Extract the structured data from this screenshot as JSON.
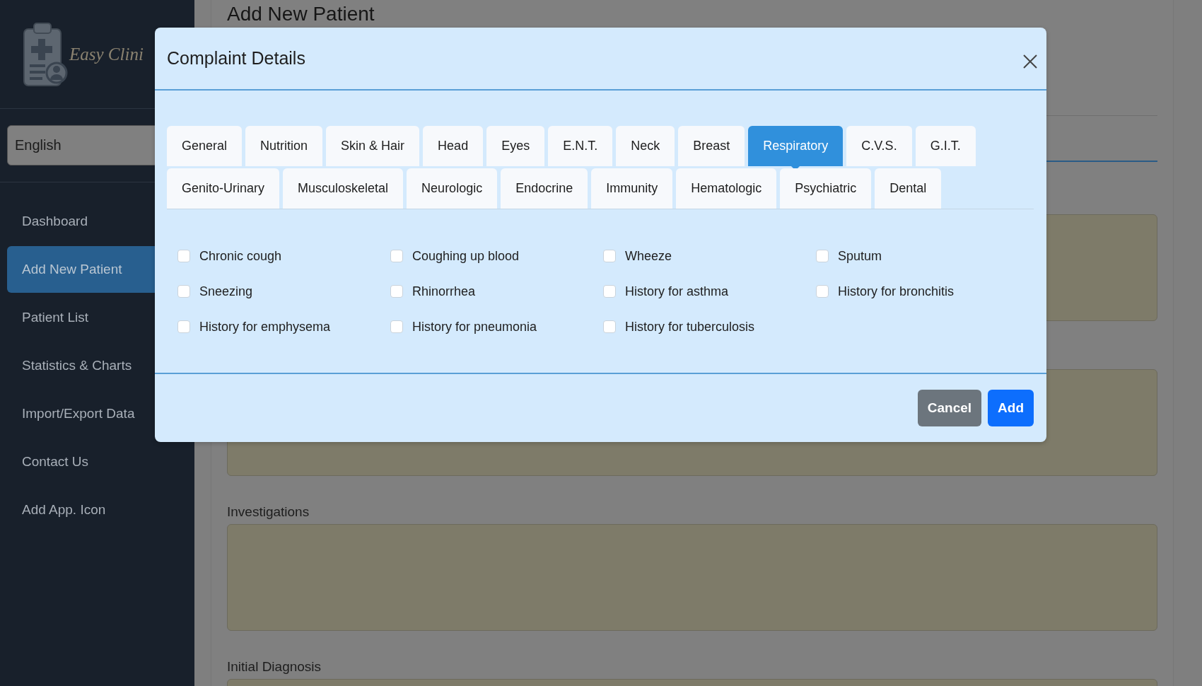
{
  "sidebar": {
    "logo_text": "Easy Clini",
    "language": "English",
    "items": [
      {
        "label": "Dashboard",
        "selected": false
      },
      {
        "label": "Add New Patient",
        "selected": true
      },
      {
        "label": "Patient List",
        "selected": false
      },
      {
        "label": "Statistics & Charts",
        "selected": false
      },
      {
        "label": "Import/Export Data",
        "selected": false
      },
      {
        "label": "Contact Us",
        "selected": false
      },
      {
        "label": "Add App. Icon",
        "selected": false
      }
    ]
  },
  "page": {
    "title": "Add New Patient",
    "fields": [
      {
        "label": "Investigations"
      },
      {
        "label": "Initial Diagnosis"
      }
    ]
  },
  "dialog": {
    "title": "Complaint Details",
    "tab_rows": [
      [
        {
          "label": "General",
          "selected": false
        },
        {
          "label": "Nutrition",
          "selected": false
        },
        {
          "label": "Skin & Hair",
          "selected": false
        },
        {
          "label": "Head",
          "selected": false
        },
        {
          "label": "Eyes",
          "selected": false
        },
        {
          "label": "E.N.T.",
          "selected": false
        },
        {
          "label": "Neck",
          "selected": false
        },
        {
          "label": "Breast",
          "selected": false
        },
        {
          "label": "Respiratory",
          "selected": true
        },
        {
          "label": "C.V.S.",
          "selected": false
        },
        {
          "label": "G.I.T.",
          "selected": false
        }
      ],
      [
        {
          "label": "Genito-Urinary",
          "selected": false
        },
        {
          "label": "Musculoskeletal",
          "selected": false
        },
        {
          "label": "Neurologic",
          "selected": false
        },
        {
          "label": "Endocrine",
          "selected": false
        },
        {
          "label": "Immunity",
          "selected": false
        },
        {
          "label": "Hematologic",
          "selected": false
        },
        {
          "label": "Psychiatric",
          "selected": false
        },
        {
          "label": "Dental",
          "selected": false
        }
      ]
    ],
    "options": [
      {
        "label": "Chronic cough",
        "checked": false
      },
      {
        "label": "Coughing up blood",
        "checked": false
      },
      {
        "label": "Wheeze",
        "checked": false
      },
      {
        "label": "Sputum",
        "checked": false
      },
      {
        "label": "Sneezing",
        "checked": false
      },
      {
        "label": "Rhinorrhea",
        "checked": false
      },
      {
        "label": "History for asthma",
        "checked": false
      },
      {
        "label": "History for bronchitis",
        "checked": false
      },
      {
        "label": "History for emphysema",
        "checked": false
      },
      {
        "label": "History for pneumonia",
        "checked": false
      },
      {
        "label": "History for tuberculosis",
        "checked": false
      }
    ],
    "buttons": [
      {
        "label": "Cancel",
        "kind": "secondary"
      },
      {
        "label": "Add",
        "kind": "primary"
      }
    ]
  }
}
